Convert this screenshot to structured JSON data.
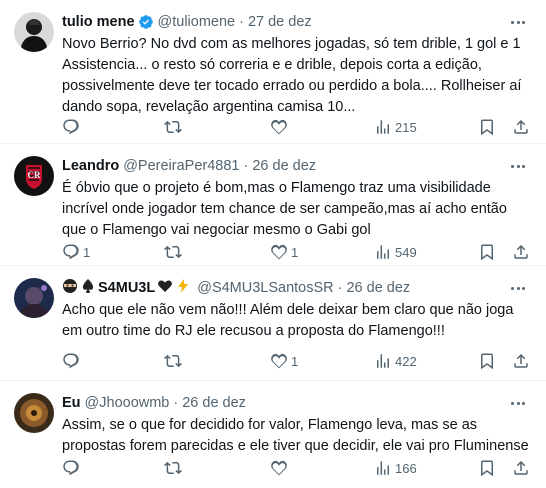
{
  "tweets": [
    {
      "name": "tulio mene",
      "handle": "@tuliomene",
      "date": "27 de dez",
      "text": "Novo Berrio? No dvd com as melhores jogadas, só tem drible, 1 gol e 1 Assistencia... o resto só correria e e drible, depois corta a edição, possivelmente deve ter tocado errado ou perdido a bola.... Rollheiser aí dando sopa, revelação argentina camisa 10...",
      "replies": "",
      "retweets": "",
      "likes": "",
      "views": "215"
    },
    {
      "name": "Leandro",
      "handle": "@PereiraPer4881",
      "date": "26 de dez",
      "text": "É óbvio que o projeto é bom,mas o Flamengo traz uma visibilidade incrível onde jogador tem chance de ser campeão,mas aí acho então que o Flamengo vai negociar mesmo o Gabi gol",
      "replies": "1",
      "retweets": "",
      "likes": "1",
      "views": "549"
    },
    {
      "name": "S4MU3L",
      "handle": "@S4MU3LSantosSR",
      "date": "26 de dez",
      "text": "Acho que ele não vem não!!! Além dele deixar bem claro que não joga em outro time do RJ ele recusou a proposta do Flamengo!!!",
      "replies": "",
      "retweets": "",
      "likes": "1",
      "views": "422"
    },
    {
      "name": "Eu",
      "handle": "@Jhooowmb",
      "date": "26 de dez",
      "text": "Assim, se o que for decidido for valor, Flamengo leva, mas se as propostas forem parecidas e ele tiver que decidir, ele vai pro Fluminense",
      "replies": "",
      "retweets": "",
      "likes": "",
      "views": "166"
    }
  ],
  "sep": "·",
  "colors": {
    "text": "#0f1419",
    "secondary": "#536471",
    "verified": "#1d9bf0",
    "border": "#eff3f4"
  }
}
